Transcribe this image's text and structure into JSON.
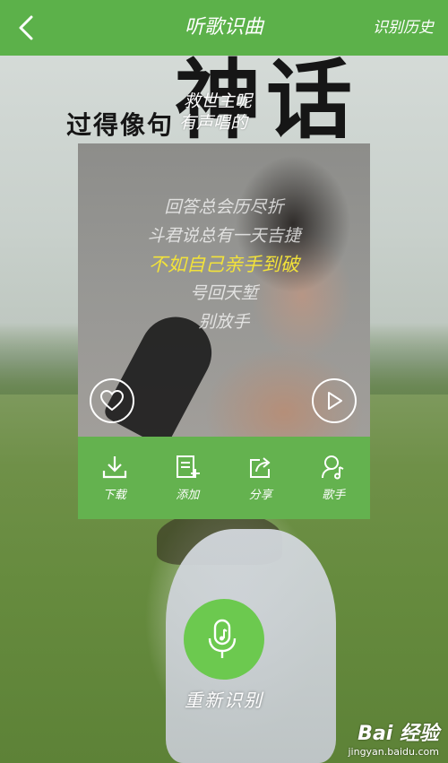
{
  "header": {
    "back_icon": "chevron-left-icon",
    "title": "听歌识曲",
    "history_label": "识别历史"
  },
  "background_overlay": {
    "big_word": "神话",
    "small_word": "过得像句",
    "lyric_1": "救世主呢",
    "lyric_2": "有声唱的"
  },
  "card": {
    "lyrics": [
      {
        "text": "回答总会历尽折",
        "active": false
      },
      {
        "text": "斗君说总有一天吉捷",
        "active": false
      },
      {
        "text": "不如自己亲手到破",
        "active": true
      },
      {
        "text": "号回天堑",
        "active": false
      },
      {
        "text": "别放手",
        "active": false
      }
    ],
    "like_icon": "heart-icon",
    "play_icon": "play-icon",
    "actions": [
      {
        "name": "download",
        "icon": "download-icon",
        "label": "下载"
      },
      {
        "name": "add",
        "icon": "add-to-list-icon",
        "label": "添加"
      },
      {
        "name": "share",
        "icon": "share-icon",
        "label": "分享"
      },
      {
        "name": "singer",
        "icon": "singer-icon",
        "label": "歌手"
      }
    ]
  },
  "record": {
    "icon": "mic-music-icon",
    "label": "重新识别"
  },
  "watermark": {
    "logo": "Bai 经验",
    "url": "jingyan.baidu.com"
  },
  "colors": {
    "header_green": "#5cb14a",
    "action_bar_green": "#64b24f",
    "record_green": "#6cc94f",
    "active_lyric": "#f2e23a"
  }
}
